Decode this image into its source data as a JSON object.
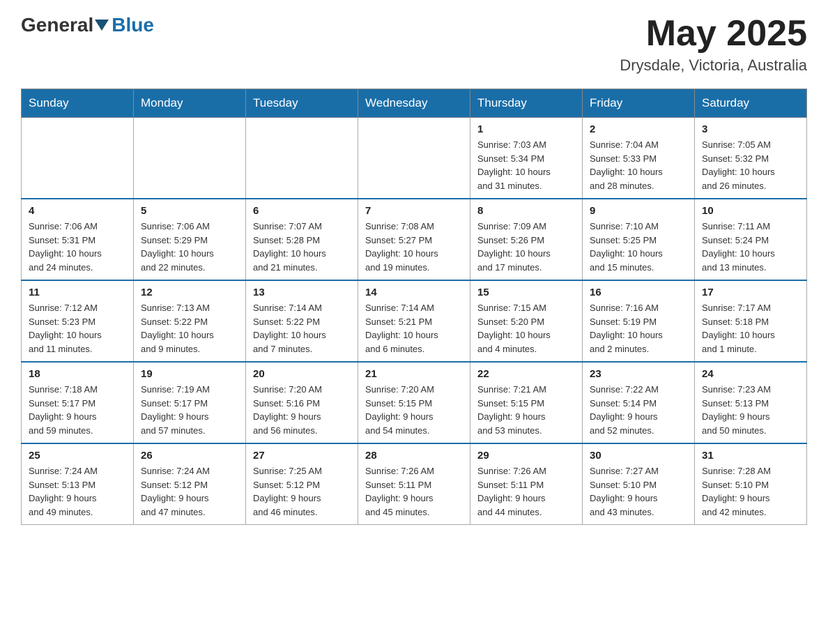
{
  "header": {
    "logo_text_general": "General",
    "logo_text_blue": "Blue",
    "month_year": "May 2025",
    "location": "Drysdale, Victoria, Australia"
  },
  "days_of_week": [
    "Sunday",
    "Monday",
    "Tuesday",
    "Wednesday",
    "Thursday",
    "Friday",
    "Saturday"
  ],
  "weeks": [
    [
      {
        "day": "",
        "info": ""
      },
      {
        "day": "",
        "info": ""
      },
      {
        "day": "",
        "info": ""
      },
      {
        "day": "",
        "info": ""
      },
      {
        "day": "1",
        "info": "Sunrise: 7:03 AM\nSunset: 5:34 PM\nDaylight: 10 hours\nand 31 minutes."
      },
      {
        "day": "2",
        "info": "Sunrise: 7:04 AM\nSunset: 5:33 PM\nDaylight: 10 hours\nand 28 minutes."
      },
      {
        "day": "3",
        "info": "Sunrise: 7:05 AM\nSunset: 5:32 PM\nDaylight: 10 hours\nand 26 minutes."
      }
    ],
    [
      {
        "day": "4",
        "info": "Sunrise: 7:06 AM\nSunset: 5:31 PM\nDaylight: 10 hours\nand 24 minutes."
      },
      {
        "day": "5",
        "info": "Sunrise: 7:06 AM\nSunset: 5:29 PM\nDaylight: 10 hours\nand 22 minutes."
      },
      {
        "day": "6",
        "info": "Sunrise: 7:07 AM\nSunset: 5:28 PM\nDaylight: 10 hours\nand 21 minutes."
      },
      {
        "day": "7",
        "info": "Sunrise: 7:08 AM\nSunset: 5:27 PM\nDaylight: 10 hours\nand 19 minutes."
      },
      {
        "day": "8",
        "info": "Sunrise: 7:09 AM\nSunset: 5:26 PM\nDaylight: 10 hours\nand 17 minutes."
      },
      {
        "day": "9",
        "info": "Sunrise: 7:10 AM\nSunset: 5:25 PM\nDaylight: 10 hours\nand 15 minutes."
      },
      {
        "day": "10",
        "info": "Sunrise: 7:11 AM\nSunset: 5:24 PM\nDaylight: 10 hours\nand 13 minutes."
      }
    ],
    [
      {
        "day": "11",
        "info": "Sunrise: 7:12 AM\nSunset: 5:23 PM\nDaylight: 10 hours\nand 11 minutes."
      },
      {
        "day": "12",
        "info": "Sunrise: 7:13 AM\nSunset: 5:22 PM\nDaylight: 10 hours\nand 9 minutes."
      },
      {
        "day": "13",
        "info": "Sunrise: 7:14 AM\nSunset: 5:22 PM\nDaylight: 10 hours\nand 7 minutes."
      },
      {
        "day": "14",
        "info": "Sunrise: 7:14 AM\nSunset: 5:21 PM\nDaylight: 10 hours\nand 6 minutes."
      },
      {
        "day": "15",
        "info": "Sunrise: 7:15 AM\nSunset: 5:20 PM\nDaylight: 10 hours\nand 4 minutes."
      },
      {
        "day": "16",
        "info": "Sunrise: 7:16 AM\nSunset: 5:19 PM\nDaylight: 10 hours\nand 2 minutes."
      },
      {
        "day": "17",
        "info": "Sunrise: 7:17 AM\nSunset: 5:18 PM\nDaylight: 10 hours\nand 1 minute."
      }
    ],
    [
      {
        "day": "18",
        "info": "Sunrise: 7:18 AM\nSunset: 5:17 PM\nDaylight: 9 hours\nand 59 minutes."
      },
      {
        "day": "19",
        "info": "Sunrise: 7:19 AM\nSunset: 5:17 PM\nDaylight: 9 hours\nand 57 minutes."
      },
      {
        "day": "20",
        "info": "Sunrise: 7:20 AM\nSunset: 5:16 PM\nDaylight: 9 hours\nand 56 minutes."
      },
      {
        "day": "21",
        "info": "Sunrise: 7:20 AM\nSunset: 5:15 PM\nDaylight: 9 hours\nand 54 minutes."
      },
      {
        "day": "22",
        "info": "Sunrise: 7:21 AM\nSunset: 5:15 PM\nDaylight: 9 hours\nand 53 minutes."
      },
      {
        "day": "23",
        "info": "Sunrise: 7:22 AM\nSunset: 5:14 PM\nDaylight: 9 hours\nand 52 minutes."
      },
      {
        "day": "24",
        "info": "Sunrise: 7:23 AM\nSunset: 5:13 PM\nDaylight: 9 hours\nand 50 minutes."
      }
    ],
    [
      {
        "day": "25",
        "info": "Sunrise: 7:24 AM\nSunset: 5:13 PM\nDaylight: 9 hours\nand 49 minutes."
      },
      {
        "day": "26",
        "info": "Sunrise: 7:24 AM\nSunset: 5:12 PM\nDaylight: 9 hours\nand 47 minutes."
      },
      {
        "day": "27",
        "info": "Sunrise: 7:25 AM\nSunset: 5:12 PM\nDaylight: 9 hours\nand 46 minutes."
      },
      {
        "day": "28",
        "info": "Sunrise: 7:26 AM\nSunset: 5:11 PM\nDaylight: 9 hours\nand 45 minutes."
      },
      {
        "day": "29",
        "info": "Sunrise: 7:26 AM\nSunset: 5:11 PM\nDaylight: 9 hours\nand 44 minutes."
      },
      {
        "day": "30",
        "info": "Sunrise: 7:27 AM\nSunset: 5:10 PM\nDaylight: 9 hours\nand 43 minutes."
      },
      {
        "day": "31",
        "info": "Sunrise: 7:28 AM\nSunset: 5:10 PM\nDaylight: 9 hours\nand 42 minutes."
      }
    ]
  ]
}
